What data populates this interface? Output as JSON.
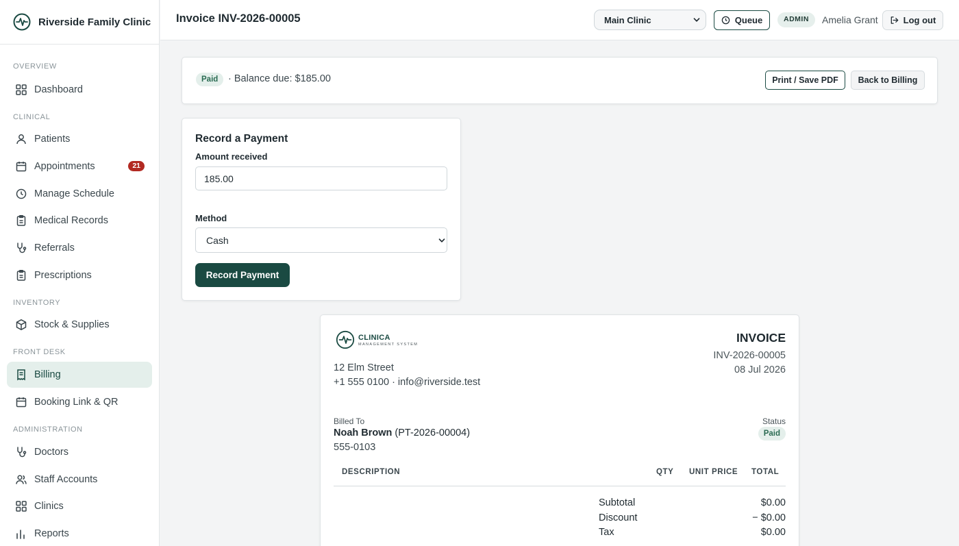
{
  "sidebar": {
    "brand": "Riverside Family Clinic",
    "sections": {
      "overview": "OVERVIEW",
      "clinical": "CLINICAL",
      "inventory": "INVENTORY",
      "front_desk": "FRONT DESK",
      "administration": "ADMINISTRATION"
    },
    "items": {
      "dashboard": "Dashboard",
      "patients": "Patients",
      "appointments": "Appointments",
      "appointments_badge": "21",
      "manage_schedule": "Manage Schedule",
      "medical_records": "Medical Records",
      "referrals": "Referrals",
      "prescriptions": "Prescriptions",
      "stock": "Stock & Supplies",
      "billing": "Billing",
      "booking_link": "Booking Link & QR",
      "doctors": "Doctors",
      "staff_accounts": "Staff Accounts",
      "clinics": "Clinics",
      "reports": "Reports"
    },
    "active_item": "billing"
  },
  "header": {
    "title": "Invoice INV-2026-00005",
    "clinic_select": "Main Clinic",
    "queue_label": "Queue",
    "role_badge": "ADMIN",
    "user_name": "Amelia Grant",
    "logout_label": "Log out"
  },
  "status_bar": {
    "status": "Paid",
    "balance_text": "· Balance due: $185.00",
    "print_label": "Print / Save PDF",
    "back_label": "Back to Billing"
  },
  "payment_form": {
    "title": "Record a Payment",
    "amount_label": "Amount received",
    "amount_value": "185.00",
    "method_label": "Method",
    "method_value": "Cash",
    "submit_label": "Record Payment"
  },
  "invoice": {
    "logo_name": "CLINICA",
    "logo_sub": "MANAGEMENT SYSTEM",
    "address": "12 Elm Street",
    "contact": "+1 555 0100 · info@riverside.test",
    "heading": "INVOICE",
    "number": "INV-2026-00005",
    "date": "08 Jul 2026",
    "billed_to_label": "Billed To",
    "patient_name": "Noah Brown",
    "patient_id": "(PT-2026-00004)",
    "patient_phone": "555-0103",
    "status_label": "Status",
    "status": "Paid",
    "columns": {
      "description": "DESCRIPTION",
      "qty": "QTY",
      "unit_price": "UNIT PRICE",
      "total": "TOTAL"
    },
    "totals": {
      "subtotal_label": "Subtotal",
      "subtotal": "$0.00",
      "discount_label": "Discount",
      "discount": "− $0.00",
      "tax_label": "Tax",
      "tax": "$0.00"
    }
  },
  "colors": {
    "accent": "#1a4a42",
    "badge_red": "#b22a22",
    "paid_bg": "#e4efeb",
    "paid_text": "#2a6b52"
  }
}
